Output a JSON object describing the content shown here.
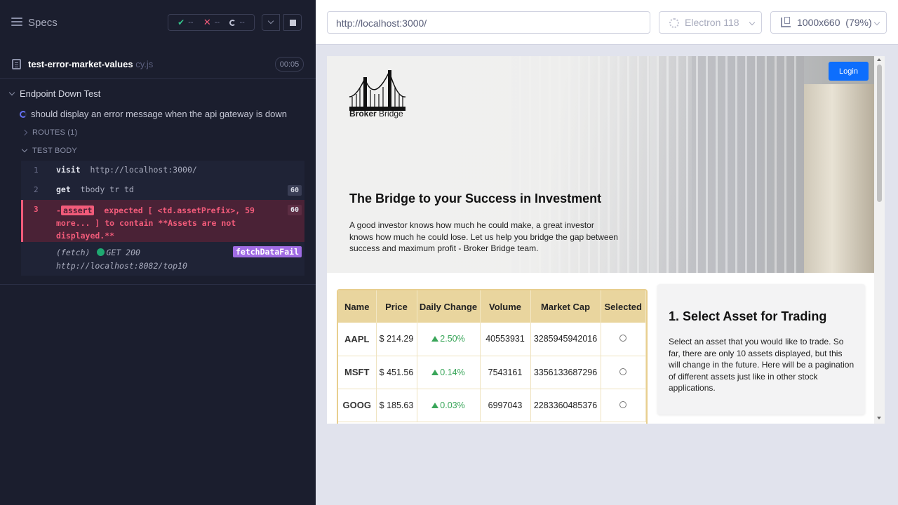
{
  "reporter": {
    "specs_label": "Specs",
    "stats": {
      "passed": "--",
      "failed": "--",
      "pending": "--"
    },
    "file": {
      "name": "test-error-market-values",
      "ext": "cy.js",
      "duration": "00:05"
    },
    "suite": "Endpoint Down Test",
    "test": "should display an error message when the api gateway is down",
    "routes_label": "ROUTES (1)",
    "test_body_label": "TEST BODY",
    "commands": [
      {
        "num": "1",
        "name": "visit",
        "arg": "http://localhost:3000/"
      },
      {
        "num": "2",
        "name": "get",
        "arg": "tbody tr td",
        "badge": "60"
      },
      {
        "num": "3",
        "prefix": "-",
        "name": "assert",
        "msg": "expected [ <td.assetPrefix>, 59 more... ] to contain **Assets are not displayed.**",
        "badge": "60"
      },
      {
        "name": "(fetch)",
        "method": "GET 200",
        "url": "http://localhost:8082/top10",
        "alias": "fetchDataFail"
      }
    ]
  },
  "aut": {
    "url": "http://localhost:3000/",
    "browser": "Electron 118",
    "viewport": "1000x660",
    "zoom": "(79%)",
    "app": {
      "logo_bold": "Broker",
      "logo_rest": " Bridge",
      "login": "Login",
      "hero_title": "The Bridge to your Success in Investment",
      "hero_text": "A good investor knows how much he could make, a great investor knows how much he could lose. Let us help you bridge the gap between success and maximum profit - Broker Bridge team.",
      "table": {
        "headers": [
          "Name",
          "Price",
          "Daily Change",
          "Volume",
          "Market Cap",
          "Selected"
        ],
        "rows": [
          {
            "name": "AAPL",
            "price": "$ 214.29",
            "change": "2.50%",
            "volume": "40553931",
            "cap": "3285945942016"
          },
          {
            "name": "MSFT",
            "price": "$ 451.56",
            "change": "0.14%",
            "volume": "7543161",
            "cap": "3356133687296"
          },
          {
            "name": "GOOG",
            "price": "$ 185.63",
            "change": "0.03%",
            "volume": "6997043",
            "cap": "2283360485376"
          }
        ]
      },
      "card": {
        "title": "1. Select Asset for Trading",
        "text": "Select an asset that you would like to trade. So far, there are only 10 assets displayed, but this will change in the future. Here will be a pagination of different assets just like in other stock applications."
      }
    }
  },
  "colors": {
    "accent": "#6470f3",
    "fail": "#f25b7a",
    "pass": "#34c48b",
    "alias": "#a06ce4",
    "login": "#0d6efd"
  }
}
